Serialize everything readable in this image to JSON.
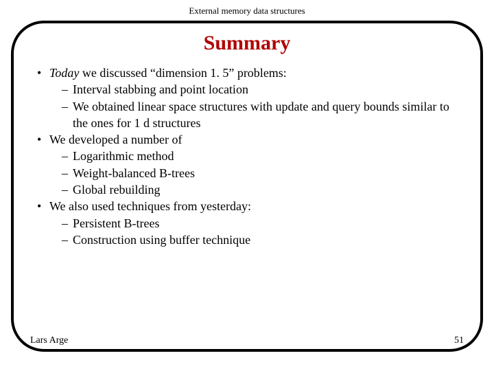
{
  "header": "External memory data structures",
  "title": "Summary",
  "bullets": [
    {
      "text_pre": "Today",
      "text_post": " we discussed “dimension 1. 5” problems:",
      "subs": [
        "Interval stabbing and point location",
        "We obtained linear space structures with update and query bounds similar to the ones for 1 d structures"
      ]
    },
    {
      "text_pre": "",
      "text_post": "We developed a number of",
      "subs": [
        "Logarithmic method",
        "Weight-balanced B-trees",
        "Global rebuilding"
      ]
    },
    {
      "text_pre": "",
      "text_post": "We also used techniques from yesterday:",
      "subs": [
        "Persistent B-trees",
        "Construction using buffer technique"
      ]
    }
  ],
  "footer_left": "Lars Arge",
  "footer_right": "51"
}
